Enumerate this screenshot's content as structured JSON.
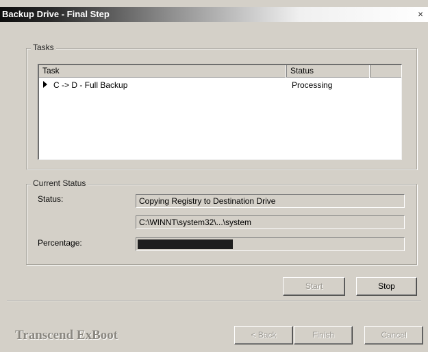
{
  "window": {
    "title": "Backup Drive - Final Step",
    "close_glyph": "×"
  },
  "tasks_group": {
    "label": "Tasks",
    "columns": [
      "Task",
      "Status"
    ],
    "rows": [
      {
        "task": "C -> D - Full Backup",
        "status": "Processing"
      }
    ]
  },
  "current_status": {
    "label": "Current Status",
    "status_label": "Status:",
    "status_value": "Copying Registry to Destination Drive",
    "path_value": "C:\\WINNT\\system32\\...\\system",
    "percentage_label": "Percentage:",
    "progress_fraction": 0.36
  },
  "actions": {
    "start_label": "Start",
    "stop_label": "Stop"
  },
  "footer": {
    "brand": "Transcend ExBoot",
    "back_label": "< Back",
    "finish_label": "Finish",
    "cancel_label": "Cancel"
  },
  "icons": {
    "row_pointer": "play-triangle-icon",
    "close": "close-icon"
  },
  "colors": {
    "dialog_bg": "#d4d0c8",
    "progress_fill": "#1e1e1e",
    "brand_text": "#8a8780"
  }
}
